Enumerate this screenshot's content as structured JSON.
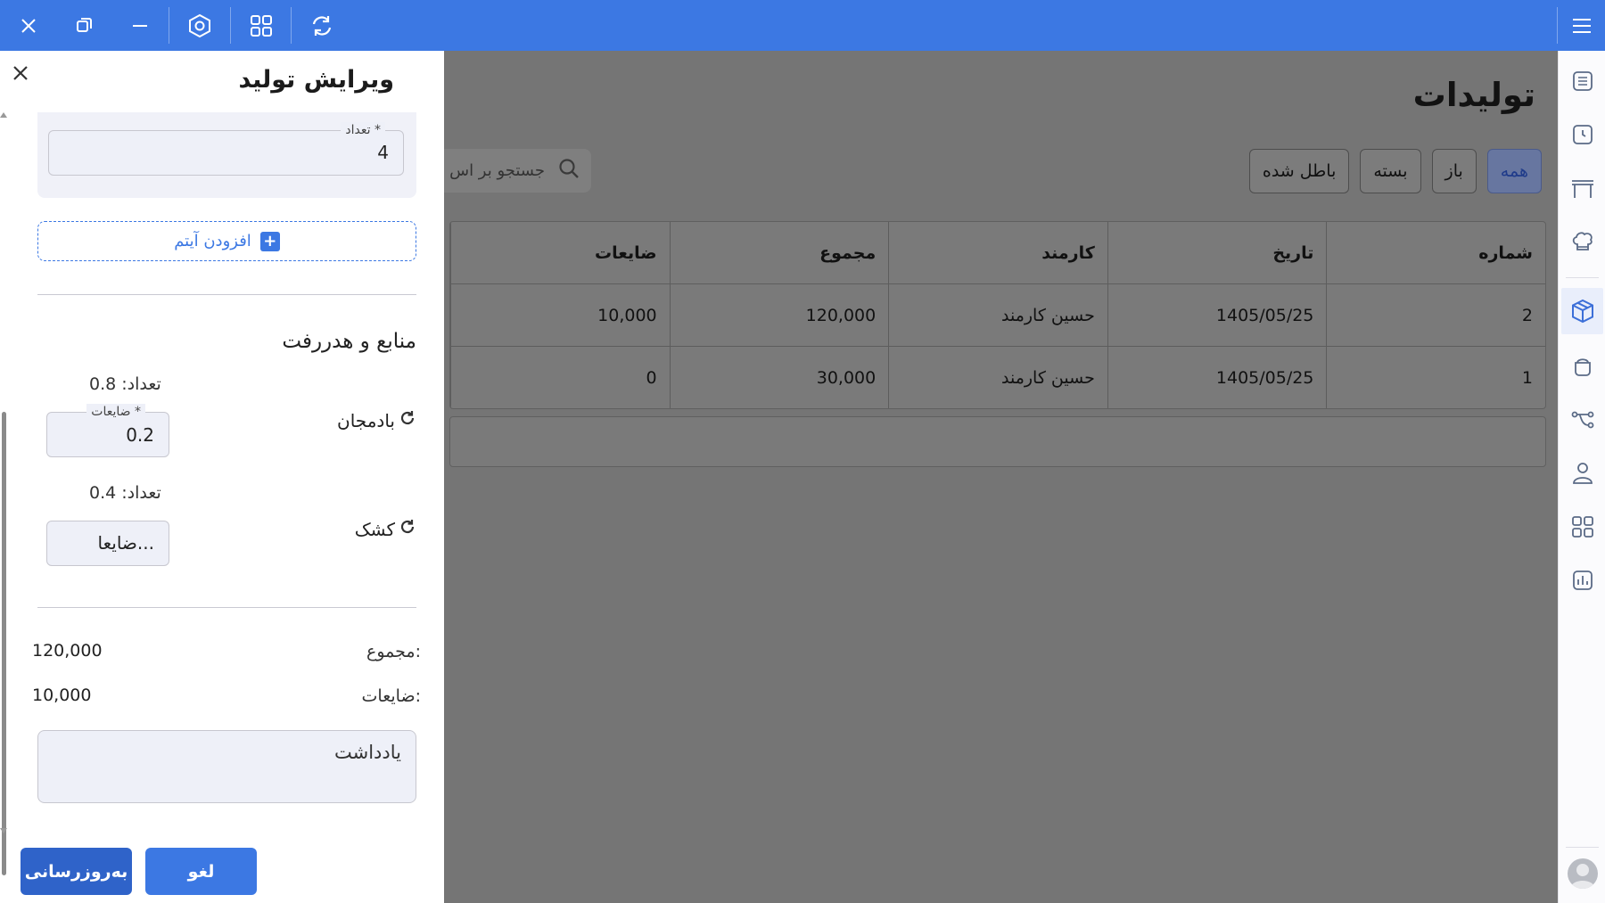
{
  "topbar": {
    "icons": [
      "close-icon",
      "restore-window-icon",
      "minimize-icon",
      "settings-hex-icon",
      "grid-apps-icon",
      "refresh-icon",
      "menu-icon"
    ],
    "color": "#3c78e3"
  },
  "sidebar": {
    "icons": [
      "list-icon",
      "clock-icon",
      "table-icon",
      "chef-hat-icon",
      "box-icon",
      "pot-icon",
      "flow-icon",
      "user-icon",
      "apps-icon",
      "chart-icon"
    ],
    "active_index": 4
  },
  "page": {
    "title": "تولیدات",
    "filters": [
      "همه",
      "باز",
      "بسته",
      "باطل شده"
    ],
    "active_filter": "همه",
    "search_placeholder": "جستجو بر اس"
  },
  "table": {
    "columns": [
      "شماره",
      "تاریخ",
      "کارمند",
      "مجموع",
      "ضایعات"
    ],
    "rows": [
      {
        "number": "2",
        "date": "1405/05/25",
        "employee": "حسین کارمند",
        "total": "120,000",
        "waste": "10,000"
      },
      {
        "number": "1",
        "date": "1405/05/25",
        "employee": "حسین کارمند",
        "total": "30,000",
        "waste": "0"
      }
    ]
  },
  "drawer": {
    "title": "ویرایش تولید",
    "item_qty_label": "تعداد *",
    "item_qty_value": "4",
    "add_item_label": "افزودن آیتم",
    "resources_title": "منابع و هدررفت",
    "resources": [
      {
        "name": "بادمجان",
        "qty_text": "تعداد: 0.8",
        "waste_label": "ضایعات *",
        "waste_value": "0.2"
      },
      {
        "name": "کشک",
        "qty_text": "تعداد: 0.4",
        "waste_placeholder": "ضایعا..."
      }
    ],
    "total_label": "مجموع:",
    "total_value": "120,000",
    "waste_label": "ضایعات:",
    "waste_value": "10,000",
    "note_placeholder": "یادداشت",
    "cancel_label": "لغو",
    "update_label": "به‌روزرسانی"
  }
}
